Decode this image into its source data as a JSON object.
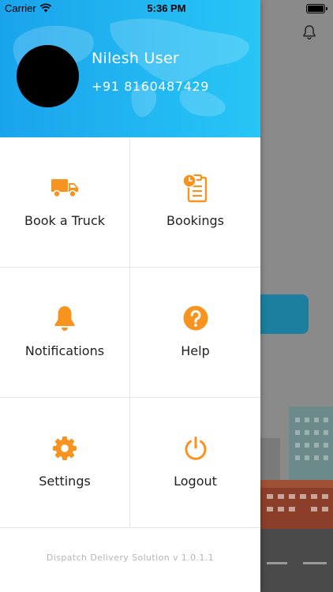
{
  "status_bar": {
    "carrier": "Carrier",
    "time": "5:36 PM"
  },
  "profile": {
    "name": "Nilesh User",
    "phone": "+91 8160487429"
  },
  "menu": [
    {
      "id": "book-truck",
      "label": "Book a Truck",
      "icon": "truck-icon"
    },
    {
      "id": "bookings",
      "label": "Bookings",
      "icon": "clipboard-clock-icon"
    },
    {
      "id": "notifications",
      "label": "Notifications",
      "icon": "bell-icon"
    },
    {
      "id": "help",
      "label": "Help",
      "icon": "question-circle-icon"
    },
    {
      "id": "settings",
      "label": "Settings",
      "icon": "gear-icon"
    },
    {
      "id": "logout",
      "label": "Logout",
      "icon": "power-icon"
    }
  ],
  "footer": {
    "version_text": "Dispatch Delivery Solution v 1.0.1.1"
  },
  "colors": {
    "accent": "#f7931e",
    "header_start": "#1aa3ec",
    "header_end": "#27c6f6"
  }
}
